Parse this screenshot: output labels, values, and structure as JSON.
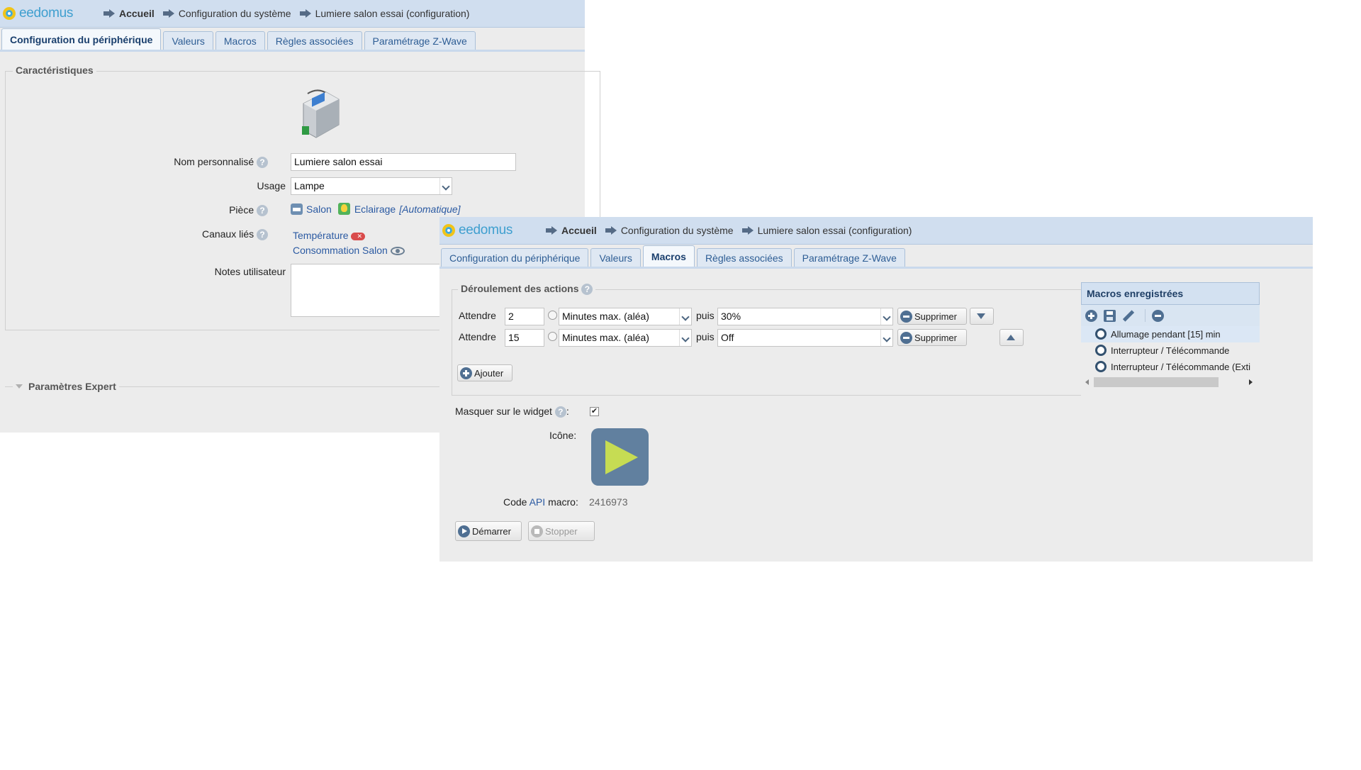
{
  "brand": {
    "name": "eedomus"
  },
  "breadcrumbs": [
    "Accueil",
    "Configuration du système",
    "Lumiere salon essai (configuration)"
  ],
  "tabs": [
    "Configuration du périphérique",
    "Valeurs",
    "Macros",
    "Règles associées",
    "Paramétrage Z-Wave"
  ],
  "window1": {
    "active_tab": "Configuration du périphérique",
    "section_title": "Caractéristiques",
    "fields": {
      "custom_name_label": "Nom personnalisé",
      "custom_name_value": "Lumiere salon essai",
      "usage_label": "Usage",
      "usage_value": "Lampe",
      "room_label": "Pièce",
      "room_value": "Salon",
      "room_category": "Eclairage",
      "room_category_note": "[Automatique]",
      "channels_label": "Canaux liés",
      "channels": [
        "Température",
        "Consommation Salon"
      ],
      "notes_label": "Notes utilisateur",
      "notes_value": ""
    },
    "expert_title": "Paramètres Expert"
  },
  "window2": {
    "active_tab": "Macros",
    "actions_title": "Déroulement des actions",
    "actions": [
      {
        "wait_label": "Attendre",
        "wait_value": "2",
        "unit": "Minutes max. (aléa)",
        "then_label": "puis",
        "value": "30%",
        "delete_label": "Supprimer"
      },
      {
        "wait_label": "Attendre",
        "wait_value": "15",
        "unit": "Minutes max. (aléa)",
        "then_label": "puis",
        "value": "Off",
        "delete_label": "Supprimer"
      }
    ],
    "add_label": "Ajouter",
    "hide_widget_label": "Masquer sur le widget",
    "hide_widget_checked": true,
    "icon_label": "Icône:",
    "api_code_prefix": "Code",
    "api_code_link": "API",
    "api_code_suffix": "macro:",
    "api_code_value": "2416973",
    "start_label": "Démarrer",
    "stop_label": "Stopper",
    "saved_macros_title": "Macros enregistrées",
    "saved_macros": [
      "Allumage pendant [15] min",
      "Interrupteur / Télécommande",
      "Interrupteur / Télécommande (Exti"
    ],
    "colors": {
      "accent": "#2d5d94",
      "play_icon_bg": "#61809f",
      "play_triangle": "#c6dc53"
    }
  }
}
